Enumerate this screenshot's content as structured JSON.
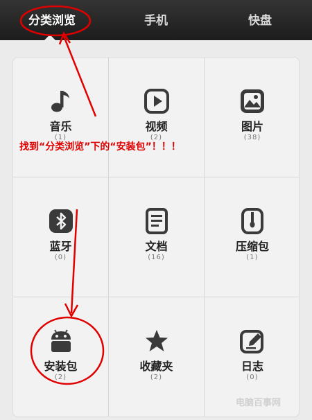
{
  "tabs": [
    {
      "label": "分类浏览"
    },
    {
      "label": "手机"
    },
    {
      "label": "快盘"
    }
  ],
  "categories": [
    {
      "label": "音乐",
      "count": "(1)",
      "icon": "music-icon"
    },
    {
      "label": "视频",
      "count": "(2)",
      "icon": "play-icon"
    },
    {
      "label": "图片",
      "count": "(38)",
      "icon": "image-icon"
    },
    {
      "label": "蓝牙",
      "count": "(0)",
      "icon": "bluetooth-icon"
    },
    {
      "label": "文档",
      "count": "(16)",
      "icon": "document-icon"
    },
    {
      "label": "压缩包",
      "count": "(1)",
      "icon": "archive-icon"
    },
    {
      "label": "安装包",
      "count": "(2)",
      "icon": "android-icon"
    },
    {
      "label": "收藏夹",
      "count": "(2)",
      "icon": "star-icon"
    },
    {
      "label": "日志",
      "count": "(0)",
      "icon": "edit-icon"
    }
  ],
  "annotation": "找到“分类浏览”下的“安装包”！！！",
  "watermark": "电脑百事网",
  "colors": {
    "annotation": "#e00000",
    "topbar": "#262626",
    "icon": "#3a3a3a"
  }
}
